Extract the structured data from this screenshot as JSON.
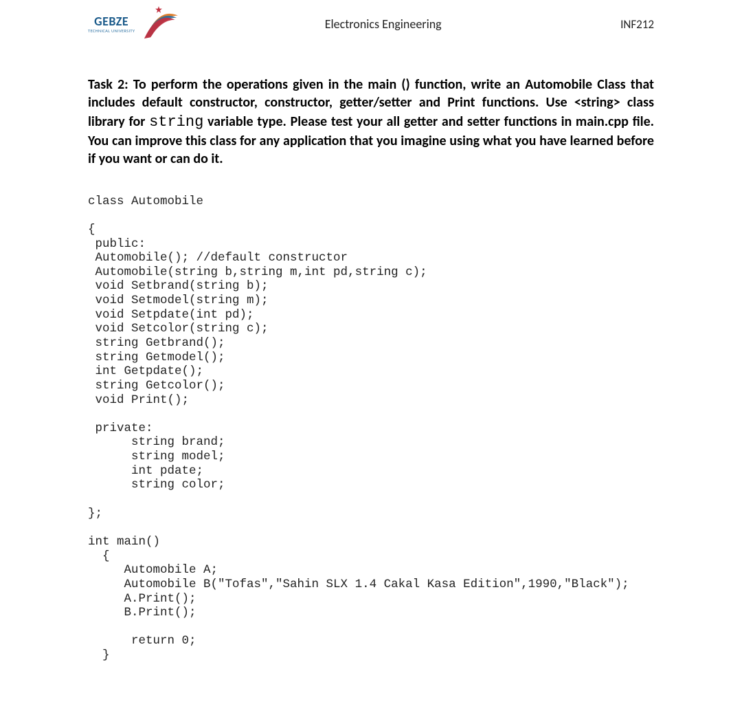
{
  "header": {
    "logo_name": "GEBZE",
    "logo_sub": "TECHNICAL UNIVERSITY",
    "center": "Electronics Engineering",
    "right": "INF212"
  },
  "task": {
    "prefix": "Task 2: To perform the operations given in the main () function, write an Automobile Class that includes default constructor, constructor, getter/setter and Print functions. Use <string> class library for ",
    "code_word": "string",
    "suffix": " variable type. Please test your all getter and setter functions in main.cpp file. You can improve this class for any application that you imagine using what you have learned before if you want or can do it."
  },
  "code": "class Automobile\n\n{\n public:\n Automobile(); //default constructor\n Automobile(string b,string m,int pd,string c);\n void Setbrand(string b);\n void Setmodel(string m);\n void Setpdate(int pd);\n void Setcolor(string c);\n string Getbrand();\n string Getmodel();\n int Getpdate();\n string Getcolor();\n void Print();\n\n private:\n      string brand;\n      string model;\n      int pdate;\n      string color;\n\n};\n\nint main()\n  {\n     Automobile A;\n     Automobile B(\"Tofas\",\"Sahin SLX 1.4 Cakal Kasa Edition\",1990,\"Black\");\n     A.Print();\n     B.Print();\n\n      return 0;\n  }"
}
